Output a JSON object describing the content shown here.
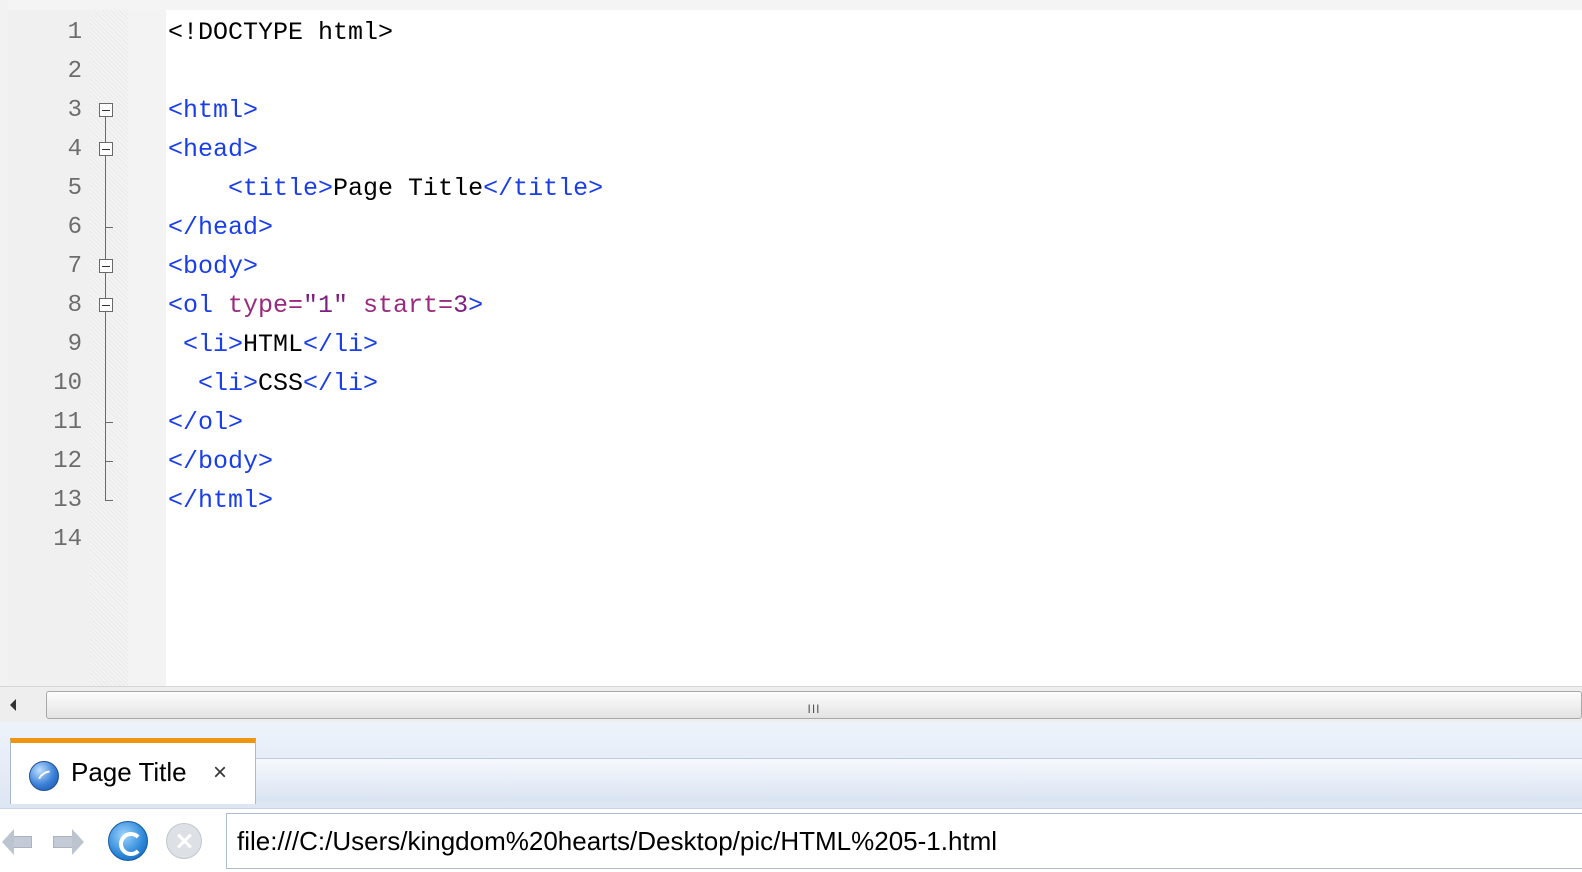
{
  "editor": {
    "lines": [
      {
        "num": "1",
        "fold": "none",
        "indent": "",
        "tokens": [
          {
            "t": "<!DOCTYPE html>",
            "c": "text"
          }
        ]
      },
      {
        "num": "2",
        "fold": "none",
        "indent": "",
        "tokens": []
      },
      {
        "num": "3",
        "fold": "open",
        "indent": "",
        "tokens": [
          {
            "t": "<html>",
            "c": "tag"
          }
        ]
      },
      {
        "num": "4",
        "fold": "open",
        "indent": "",
        "tokens": [
          {
            "t": "<head>",
            "c": "tag"
          }
        ]
      },
      {
        "num": "5",
        "fold": "line",
        "indent": "    ",
        "tokens": [
          {
            "t": "<title>",
            "c": "tag"
          },
          {
            "t": "Page Title",
            "c": "text"
          },
          {
            "t": "</title>",
            "c": "tag"
          }
        ]
      },
      {
        "num": "6",
        "fold": "end",
        "indent": "",
        "tokens": [
          {
            "t": "</head>",
            "c": "tag"
          }
        ]
      },
      {
        "num": "7",
        "fold": "open",
        "indent": "",
        "tokens": [
          {
            "t": "<body>",
            "c": "tag"
          }
        ]
      },
      {
        "num": "8",
        "fold": "open",
        "indent": "",
        "tokens": [
          {
            "t": "<ol",
            "c": "tag"
          },
          {
            "t": " type=",
            "c": "attr"
          },
          {
            "t": "\"1\"",
            "c": "val"
          },
          {
            "t": " start=",
            "c": "attr"
          },
          {
            "t": "3",
            "c": "val"
          },
          {
            "t": ">",
            "c": "tag"
          }
        ]
      },
      {
        "num": "9",
        "fold": "line",
        "indent": " ",
        "tokens": [
          {
            "t": "<li>",
            "c": "tag"
          },
          {
            "t": "HTML",
            "c": "text"
          },
          {
            "t": "</li>",
            "c": "tag"
          }
        ]
      },
      {
        "num": "10",
        "fold": "line",
        "indent": "  ",
        "tokens": [
          {
            "t": "<li>",
            "c": "tag"
          },
          {
            "t": "CSS",
            "c": "text"
          },
          {
            "t": "</li>",
            "c": "tag"
          }
        ]
      },
      {
        "num": "11",
        "fold": "end",
        "indent": "",
        "tokens": [
          {
            "t": "</ol>",
            "c": "tag"
          }
        ]
      },
      {
        "num": "12",
        "fold": "end",
        "indent": "",
        "tokens": [
          {
            "t": "</body>",
            "c": "tag"
          }
        ]
      },
      {
        "num": "13",
        "fold": "last",
        "indent": "",
        "tokens": [
          {
            "t": "</html>",
            "c": "tag"
          }
        ]
      },
      {
        "num": "14",
        "fold": "none",
        "indent": "",
        "tokens": []
      }
    ],
    "colors": {
      "tag": "#1a3ee8",
      "attr": "#9a2a7d",
      "value": "#7d1f7f",
      "text": "#000000",
      "line_number": "#6d6d6d"
    }
  },
  "scrollbar": {
    "grip_label": "III"
  },
  "browser": {
    "tab": {
      "title": "Page Title",
      "close_label": "×",
      "icon": "globe-icon"
    },
    "nav": {
      "back_icon": "back-arrow-icon",
      "forward_icon": "forward-arrow-icon",
      "refresh_icon": "refresh-icon",
      "stop_icon": "stop-icon"
    },
    "address": {
      "url": "file:///C:/Users/kingdom%20hearts/Desktop/pic/HTML%205-1.html"
    },
    "accent_color": "#f0960e"
  }
}
